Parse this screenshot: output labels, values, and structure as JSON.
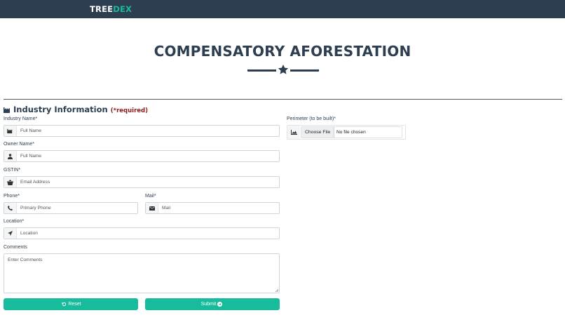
{
  "navbar": {
    "brand_part1": "TREE",
    "brand_part2": "DEX"
  },
  "page_title": "COMPENSATORY AFORESTATION",
  "section": {
    "title": "Industry Information",
    "required_note": "(*required)",
    "icon": "industry-icon"
  },
  "form": {
    "industry_name": {
      "label": "Industry Name*",
      "placeholder": "Full Name",
      "icon": "industry-icon"
    },
    "owner_name": {
      "label": "Owner Name*",
      "placeholder": "Full Name",
      "icon": "user-icon"
    },
    "gstin": {
      "label": "GSTIN*",
      "placeholder": "Email Address",
      "icon": "basket-icon"
    },
    "phone": {
      "label": "Phone*",
      "placeholder": "Primary Phone",
      "icon": "phone-icon"
    },
    "mail": {
      "label": "Mail*",
      "placeholder": "Mail",
      "icon": "envelope-icon"
    },
    "location": {
      "label": "Location*",
      "placeholder": "Location",
      "icon": "location-arrow-icon"
    },
    "comments": {
      "label": "Comments",
      "placeholder": "Enter Comments"
    },
    "perimeter": {
      "label": "Perimeter (to be built)*",
      "button": "Choose File",
      "status": "No file chosen",
      "icon": "image-icon"
    }
  },
  "buttons": {
    "reset": "Reset",
    "submit": "Submit"
  },
  "colors": {
    "navbar": "#2c3e50",
    "accent": "#18bc9c",
    "required": "#8b1a1a"
  }
}
